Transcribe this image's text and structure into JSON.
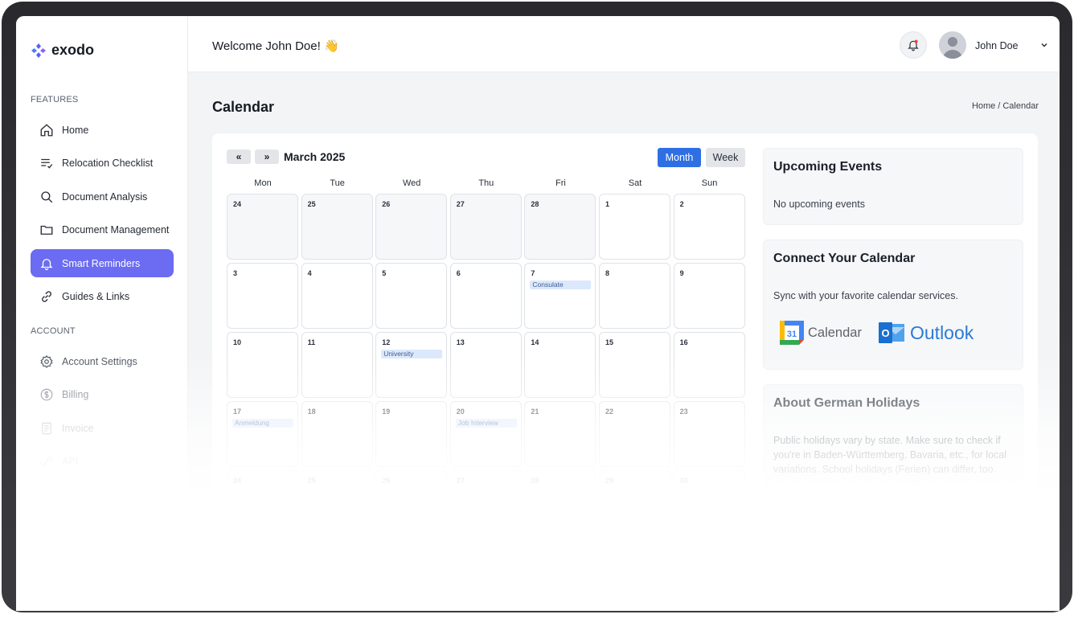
{
  "brand": {
    "name": "exodo"
  },
  "sidebar": {
    "features_title": "FEATURES",
    "account_title": "ACCOUNT",
    "items": [
      {
        "label": "Home",
        "icon": "home-icon"
      },
      {
        "label": "Relocation Checklist",
        "icon": "checklist-icon"
      },
      {
        "label": "Document Analysis",
        "icon": "search-icon"
      },
      {
        "label": "Document Management",
        "icon": "folder-icon"
      },
      {
        "label": "Smart Reminders",
        "icon": "bell-icon",
        "active": true
      },
      {
        "label": "Guides & Links",
        "icon": "link-icon"
      }
    ],
    "account_items": [
      {
        "label": "Account Settings",
        "icon": "gear-icon"
      },
      {
        "label": "Billing",
        "icon": "dollar-icon"
      },
      {
        "label": "Invoice",
        "icon": "document-icon"
      },
      {
        "label": "API",
        "icon": "api-icon"
      }
    ]
  },
  "header": {
    "welcome": "Welcome John Doe! 👋",
    "user_name": "John Doe"
  },
  "page": {
    "title": "Calendar",
    "breadcrumb": {
      "home": "Home",
      "sep": "/",
      "current": "Calendar"
    }
  },
  "calendar": {
    "prev_label": "«",
    "next_label": "»",
    "month_label": "March 2025",
    "view_month": "Month",
    "view_week": "Week",
    "weekdays": [
      "Mon",
      "Tue",
      "Wed",
      "Thu",
      "Fri",
      "Sat",
      "Sun"
    ],
    "weeks": [
      [
        {
          "day": "24",
          "prev": true
        },
        {
          "day": "25",
          "prev": true
        },
        {
          "day": "26",
          "prev": true
        },
        {
          "day": "27",
          "prev": true
        },
        {
          "day": "28",
          "prev": true
        },
        {
          "day": "1"
        },
        {
          "day": "2"
        }
      ],
      [
        {
          "day": "3"
        },
        {
          "day": "4"
        },
        {
          "day": "5"
        },
        {
          "day": "6"
        },
        {
          "day": "7",
          "event": "Consulate"
        },
        {
          "day": "8"
        },
        {
          "day": "9"
        }
      ],
      [
        {
          "day": "10"
        },
        {
          "day": "11"
        },
        {
          "day": "12",
          "event": "University"
        },
        {
          "day": "13"
        },
        {
          "day": "14"
        },
        {
          "day": "15"
        },
        {
          "day": "16"
        }
      ],
      [
        {
          "day": "17",
          "event": "Anmeldung"
        },
        {
          "day": "18"
        },
        {
          "day": "19"
        },
        {
          "day": "20",
          "event": "Job Interview"
        },
        {
          "day": "21"
        },
        {
          "day": "22"
        },
        {
          "day": "23"
        }
      ],
      [
        {
          "day": "24"
        },
        {
          "day": "25"
        },
        {
          "day": "26"
        },
        {
          "day": "27"
        },
        {
          "day": "28"
        },
        {
          "day": "29"
        },
        {
          "day": "30"
        }
      ]
    ]
  },
  "upcoming": {
    "title": "Upcoming Events",
    "empty_text": "No upcoming events"
  },
  "connect": {
    "title": "Connect Your Calendar",
    "text": "Sync with your favorite calendar services.",
    "google_label": "Calendar",
    "google_badge": "31",
    "outlook_label": "Outlook",
    "outlook_badge": "O"
  },
  "holidays": {
    "title": "About German Holidays",
    "text": "Public holidays vary by state. Make sure to check if you're in Baden-Württemberg, Bavaria, etc., for local variations. School holidays (Ferien) can differ, too."
  },
  "colors": {
    "accent": "#6b6cf2",
    "primary_button": "#2f6fe4",
    "event_bg": "#dce8fb"
  }
}
